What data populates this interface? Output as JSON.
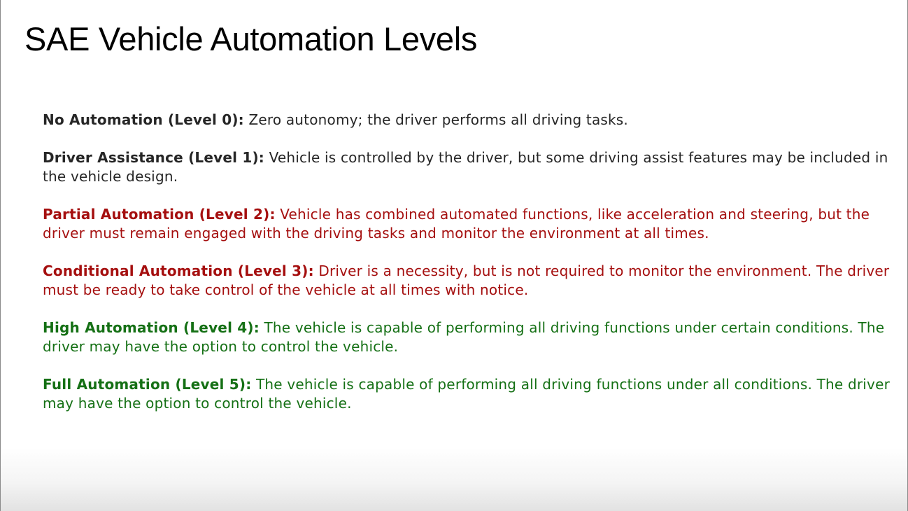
{
  "slide": {
    "title": "SAE Vehicle Automation Levels",
    "levels": [
      {
        "heading": "No Automation (Level 0):",
        "text": "Zero autonomy; the driver performs all driving tasks.",
        "color": "#262626"
      },
      {
        "heading": "Driver Assistance (Level 1):",
        "text": "Vehicle is controlled by the driver, but some driving assist features may be included in the vehicle design.",
        "color": "#262626"
      },
      {
        "heading": "Partial Automation (Level 2):",
        "text": "Vehicle has combined automated functions, like acceleration and steering, but the driver must remain engaged with the driving tasks and monitor the environment at all times.",
        "color": "#a50f0f"
      },
      {
        "heading": "Conditional Automation (Level 3):",
        "text": "Driver is a necessity, but is not required to monitor the environment. The driver must be ready to take control of the vehicle at all times with notice.",
        "color": "#a50f0f"
      },
      {
        "heading": "High Automation (Level 4):",
        "text": "The vehicle is capable of performing all driving functions under certain conditions. The driver may have the option to control the vehicle.",
        "color": "#157015"
      },
      {
        "heading": "Full Automation (Level 5):",
        "text": "The vehicle is capable of performing all driving functions under all conditions. The driver may have the option to control the vehicle.",
        "color": "#157015"
      }
    ]
  }
}
